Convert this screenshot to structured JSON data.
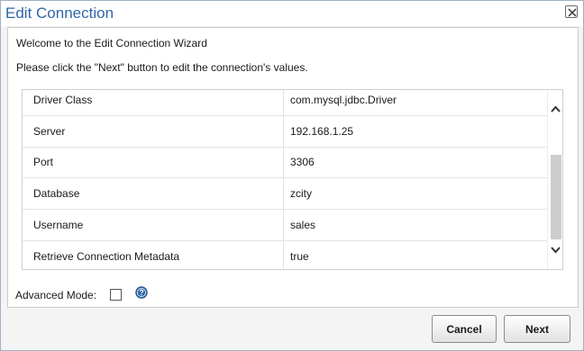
{
  "dialog": {
    "title": "Edit Connection"
  },
  "wizard": {
    "welcome": "Welcome to the Edit Connection Wizard",
    "instruction": "Please click the \"Next\" button to edit the connection's values."
  },
  "properties": [
    {
      "name": "Driver Class",
      "value": "com.mysql.jdbc.Driver"
    },
    {
      "name": "Server",
      "value": "192.168.1.25"
    },
    {
      "name": "Port",
      "value": "3306"
    },
    {
      "name": "Database",
      "value": "zcity"
    },
    {
      "name": "Username",
      "value": "sales"
    },
    {
      "name": "Retrieve Connection Metadata",
      "value": "true"
    }
  ],
  "advanced": {
    "label": "Advanced Mode:",
    "checked": false
  },
  "buttons": {
    "cancel": "Cancel",
    "next": "Next"
  },
  "colors": {
    "title": "#2f67a8",
    "help_icon": "#2f67a8"
  },
  "icons": {
    "close": "close-icon",
    "help": "help-icon",
    "scroll_up": "chevron-up-icon",
    "scroll_down": "chevron-down-icon"
  }
}
